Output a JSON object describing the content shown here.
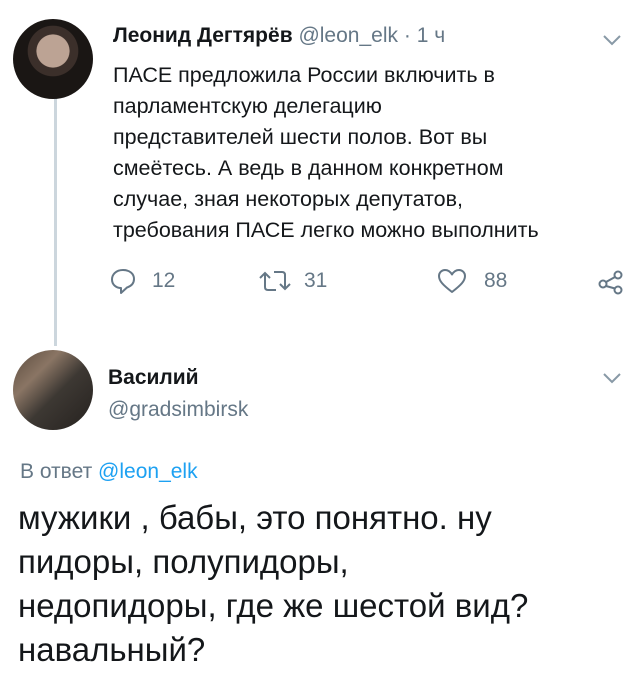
{
  "tweet": {
    "author_name": "Леонид Дегтярёв",
    "handle": "@leon_elk",
    "separator": "·",
    "time": "1 ч",
    "text_lines": [
      "ПАСЕ предложила России включить в",
      "парламентскую делегацию",
      "представителей шести полов. Вот вы",
      "смеётесь. А ведь в данном конкретном",
      "случае, зная некоторых депутатов,",
      "требования ПАСЕ легко можно выполнить"
    ],
    "replies_count": "12",
    "retweets_count": "31",
    "likes_count": "88",
    "icons": [
      "reply-icon",
      "retweet-icon",
      "like-icon",
      "share-icon",
      "chevron-down-icon"
    ]
  },
  "reply": {
    "author_name": "Василий",
    "handle": "@gradsimbirsk",
    "reply_prefix": "В ответ",
    "reply_to_handle": "@leon_elk",
    "text_lines": [
      "мужики , бабы, это понятно. ну",
      "пидоры, полупидоры,",
      "недопидоры, где же шестой вид?",
      "навальный?"
    ]
  },
  "colors": {
    "text": "#14171a",
    "muted": "#657786",
    "link": "#1da1f2",
    "thread_line": "#ccd6dd"
  }
}
